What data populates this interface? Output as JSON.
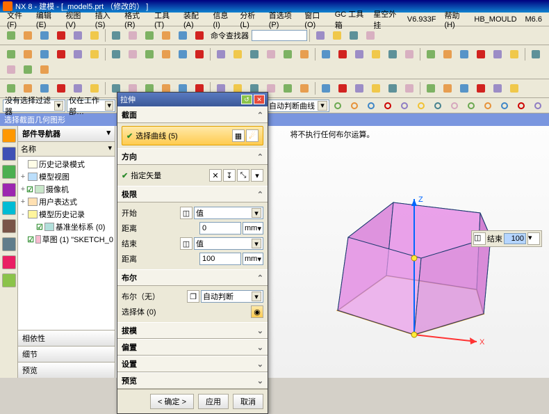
{
  "title": "NX 8 - 建模 - [_model5.prt （修改的） ]",
  "menus": [
    "文件(F)",
    "编辑(E)",
    "视图(V)",
    "插入(S)",
    "格式(R)",
    "工具(T)",
    "装配(A)",
    "信息(I)",
    "分析(L)",
    "首选项(P)",
    "窗口(O)",
    "GC 工具箱",
    "星空外挂",
    "V6.933F",
    "帮助(H)",
    "HB_MOULD",
    "M6.6"
  ],
  "cmd_finder_label": "命令查找器",
  "filter1": "没有选择过滤器",
  "filter2": "仅在工作部…",
  "filter3": "自动判断曲线",
  "sel_header": "选择截面几何图形",
  "nav": {
    "title": "部件导航器",
    "col": "名称",
    "items": [
      {
        "icon": "clock",
        "label": "历史记录模式",
        "indent": 0,
        "exp": ""
      },
      {
        "icon": "cube",
        "label": "模型视图",
        "indent": 0,
        "exp": "+"
      },
      {
        "icon": "cam",
        "label": "摄像机",
        "indent": 0,
        "exp": "+",
        "check": true
      },
      {
        "icon": "user",
        "label": "用户表达式",
        "indent": 0,
        "exp": "+"
      },
      {
        "icon": "folder",
        "label": "模型历史记录",
        "indent": 0,
        "exp": "-"
      },
      {
        "icon": "csys",
        "label": "基准坐标系 (0)",
        "indent": 1,
        "exp": "",
        "check": true
      },
      {
        "icon": "sketch",
        "label": "草图 (1) \"SKETCH_0",
        "indent": 1,
        "exp": "",
        "check": true
      }
    ],
    "footers": [
      "相依性",
      "细节",
      "预览"
    ]
  },
  "viewport": {
    "status": "将不执行任何布尔运算。",
    "floating": {
      "label": "结束",
      "value": "100"
    }
  },
  "dialog": {
    "title": "拉伸",
    "sections": {
      "section_curve": {
        "hdr": "截面",
        "row": "选择曲线 (5)"
      },
      "direction": {
        "hdr": "方向",
        "row": "指定矢量"
      },
      "limits": {
        "hdr": "极限",
        "start_label": "开始",
        "start_opt": "值",
        "start_dist_label": "距离",
        "start_dist": "0",
        "start_unit": "mm",
        "end_label": "结束",
        "end_opt": "值",
        "end_dist_label": "距离",
        "end_dist": "100",
        "end_unit": "mm"
      },
      "boolean": {
        "hdr": "布尔",
        "row": "布尔（无）",
        "opt": "自动判断",
        "sel": "选择体 (0)"
      },
      "draft": {
        "hdr": "拔模"
      },
      "offset": {
        "hdr": "偏置"
      },
      "settings": {
        "hdr": "设置"
      },
      "preview": {
        "hdr": "预览"
      }
    },
    "buttons": {
      "ok": "< 确定 >",
      "apply": "应用",
      "cancel": "取消"
    }
  },
  "chart_data": {
    "type": "table",
    "note": "3D extrude preview of pentagonal prism height 100",
    "axes": [
      "X",
      "Z"
    ]
  }
}
